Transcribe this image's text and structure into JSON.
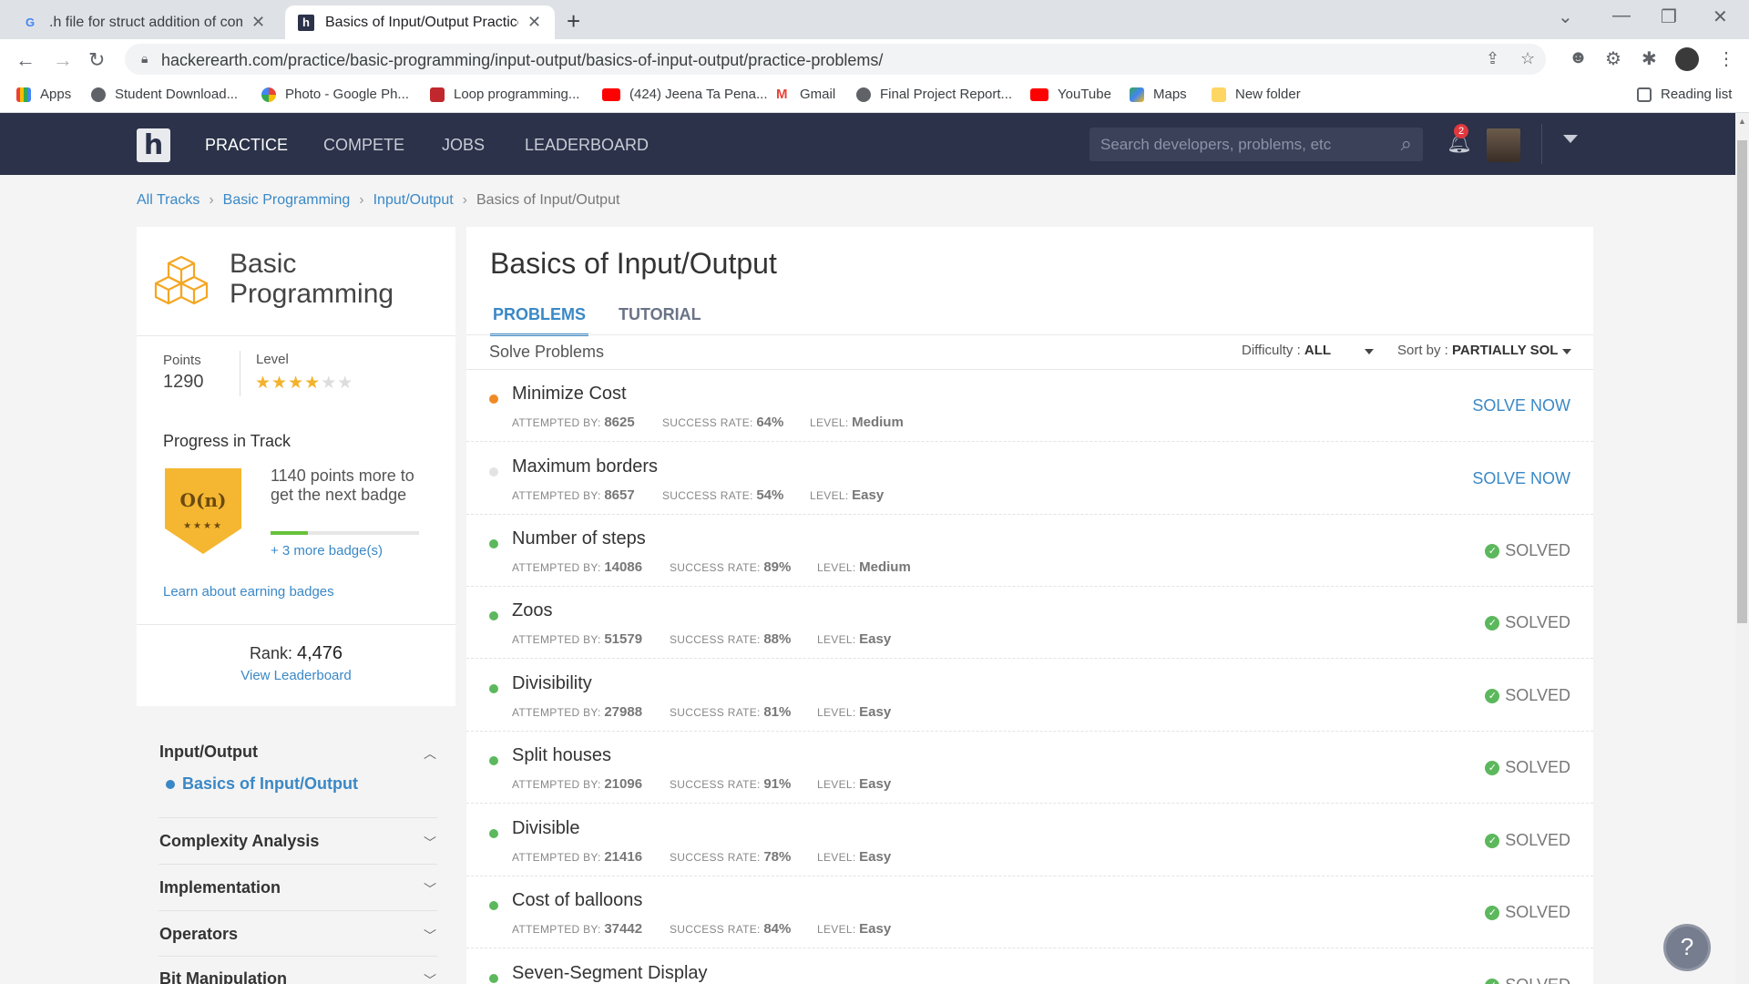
{
  "browser": {
    "tabs": [
      {
        "title": ".h file for struct addition of comp",
        "active": false
      },
      {
        "title": "Basics of Input/Output Practice P",
        "active": true
      }
    ],
    "url": "hackerearth.com/practice/basic-programming/input-output/basics-of-input-output/practice-problems/",
    "bookmarks": [
      "Apps",
      "Student Download...",
      "Photo - Google Ph...",
      "Loop programming...",
      "(424) Jeena Ta Pena...",
      "Gmail",
      "Final Project Report...",
      "YouTube",
      "Maps",
      "New folder"
    ],
    "reading_list": "Reading list"
  },
  "nav": {
    "logo": "h",
    "links": [
      "PRACTICE",
      "COMPETE",
      "JOBS",
      "LEADERBOARD"
    ],
    "search_placeholder": "Search developers, problems, etc",
    "notifications": "2"
  },
  "breadcrumb": [
    "All Tracks",
    "Basic Programming",
    "Input/Output",
    "Basics of Input/Output"
  ],
  "track": {
    "name": "Basic Programming",
    "points_label": "Points",
    "points": "1290",
    "level_label": "Level",
    "level_stars": 4,
    "level_max": 6,
    "progress_title": "Progress in Track",
    "badge_symbol": "O(n)",
    "badge_stars": "★★★★",
    "badge_text": "1140 points more to get the next badge",
    "progress_fraction": 0.25,
    "more_badges": "+ 3 more badge(s)",
    "learn_link": "Learn about earning badges",
    "rank_label": "Rank:",
    "rank": "4,476",
    "leaderboard_link": "View Leaderboard"
  },
  "topics": {
    "current": "Input/Output",
    "current_sub": "Basics of Input/Output",
    "others": [
      "Complexity Analysis",
      "Implementation",
      "Operators",
      "Bit Manipulation"
    ]
  },
  "main": {
    "title": "Basics of Input/Output",
    "tabs": [
      "PROBLEMS",
      "TUTORIAL"
    ],
    "solve_label": "Solve Problems",
    "difficulty_label": "Difficulty :",
    "difficulty_value": "ALL",
    "sort_label": "Sort by :",
    "sort_value": "PARTIALLY SOL",
    "meta_labels": {
      "attempted": "ATTEMPTED BY:",
      "success": "SUCCESS RATE:",
      "level": "LEVEL:"
    },
    "solve_now": "SOLVE NOW",
    "solved": "SOLVED",
    "problems": [
      {
        "name": "Minimize Cost",
        "attempted": "8625",
        "success": "64%",
        "level": "Medium",
        "status": "partial"
      },
      {
        "name": "Maximum borders",
        "attempted": "8657",
        "success": "54%",
        "level": "Easy",
        "status": "unsolved"
      },
      {
        "name": "Number of steps",
        "attempted": "14086",
        "success": "89%",
        "level": "Medium",
        "status": "solved"
      },
      {
        "name": "Zoos",
        "attempted": "51579",
        "success": "88%",
        "level": "Easy",
        "status": "solved"
      },
      {
        "name": "Divisibility",
        "attempted": "27988",
        "success": "81%",
        "level": "Easy",
        "status": "solved"
      },
      {
        "name": "Split houses",
        "attempted": "21096",
        "success": "91%",
        "level": "Easy",
        "status": "solved"
      },
      {
        "name": "Divisible",
        "attempted": "21416",
        "success": "78%",
        "level": "Easy",
        "status": "solved"
      },
      {
        "name": "Cost of balloons",
        "attempted": "37442",
        "success": "84%",
        "level": "Easy",
        "status": "solved"
      },
      {
        "name": "Seven-Segment Display",
        "attempted": "",
        "success": "",
        "level": "",
        "status": "solved"
      }
    ]
  },
  "colors": {
    "accent": "#3a88c6",
    "nav_bg": "#2b3249",
    "partial": "#f08a24",
    "solved": "#5cb85c",
    "unsolved": "#e3e3e3"
  }
}
